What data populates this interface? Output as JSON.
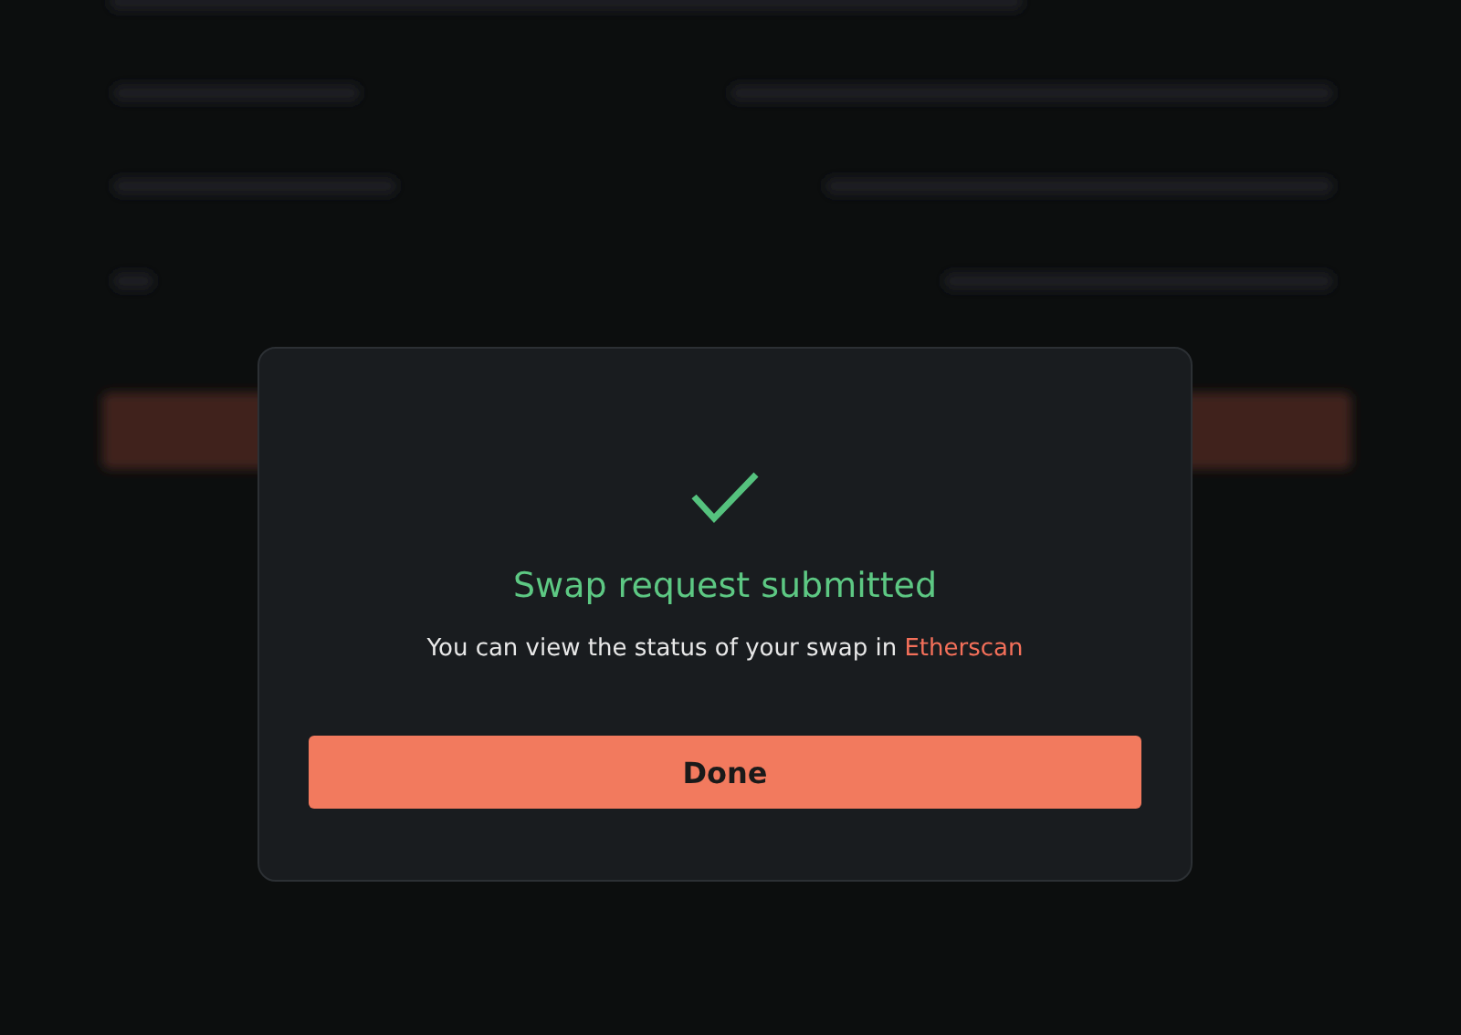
{
  "dialog": {
    "title": "Swap request submitted",
    "message": {
      "text": "You can view the status of your swap in ",
      "link": "Etherscan"
    },
    "button": "Done"
  }
}
